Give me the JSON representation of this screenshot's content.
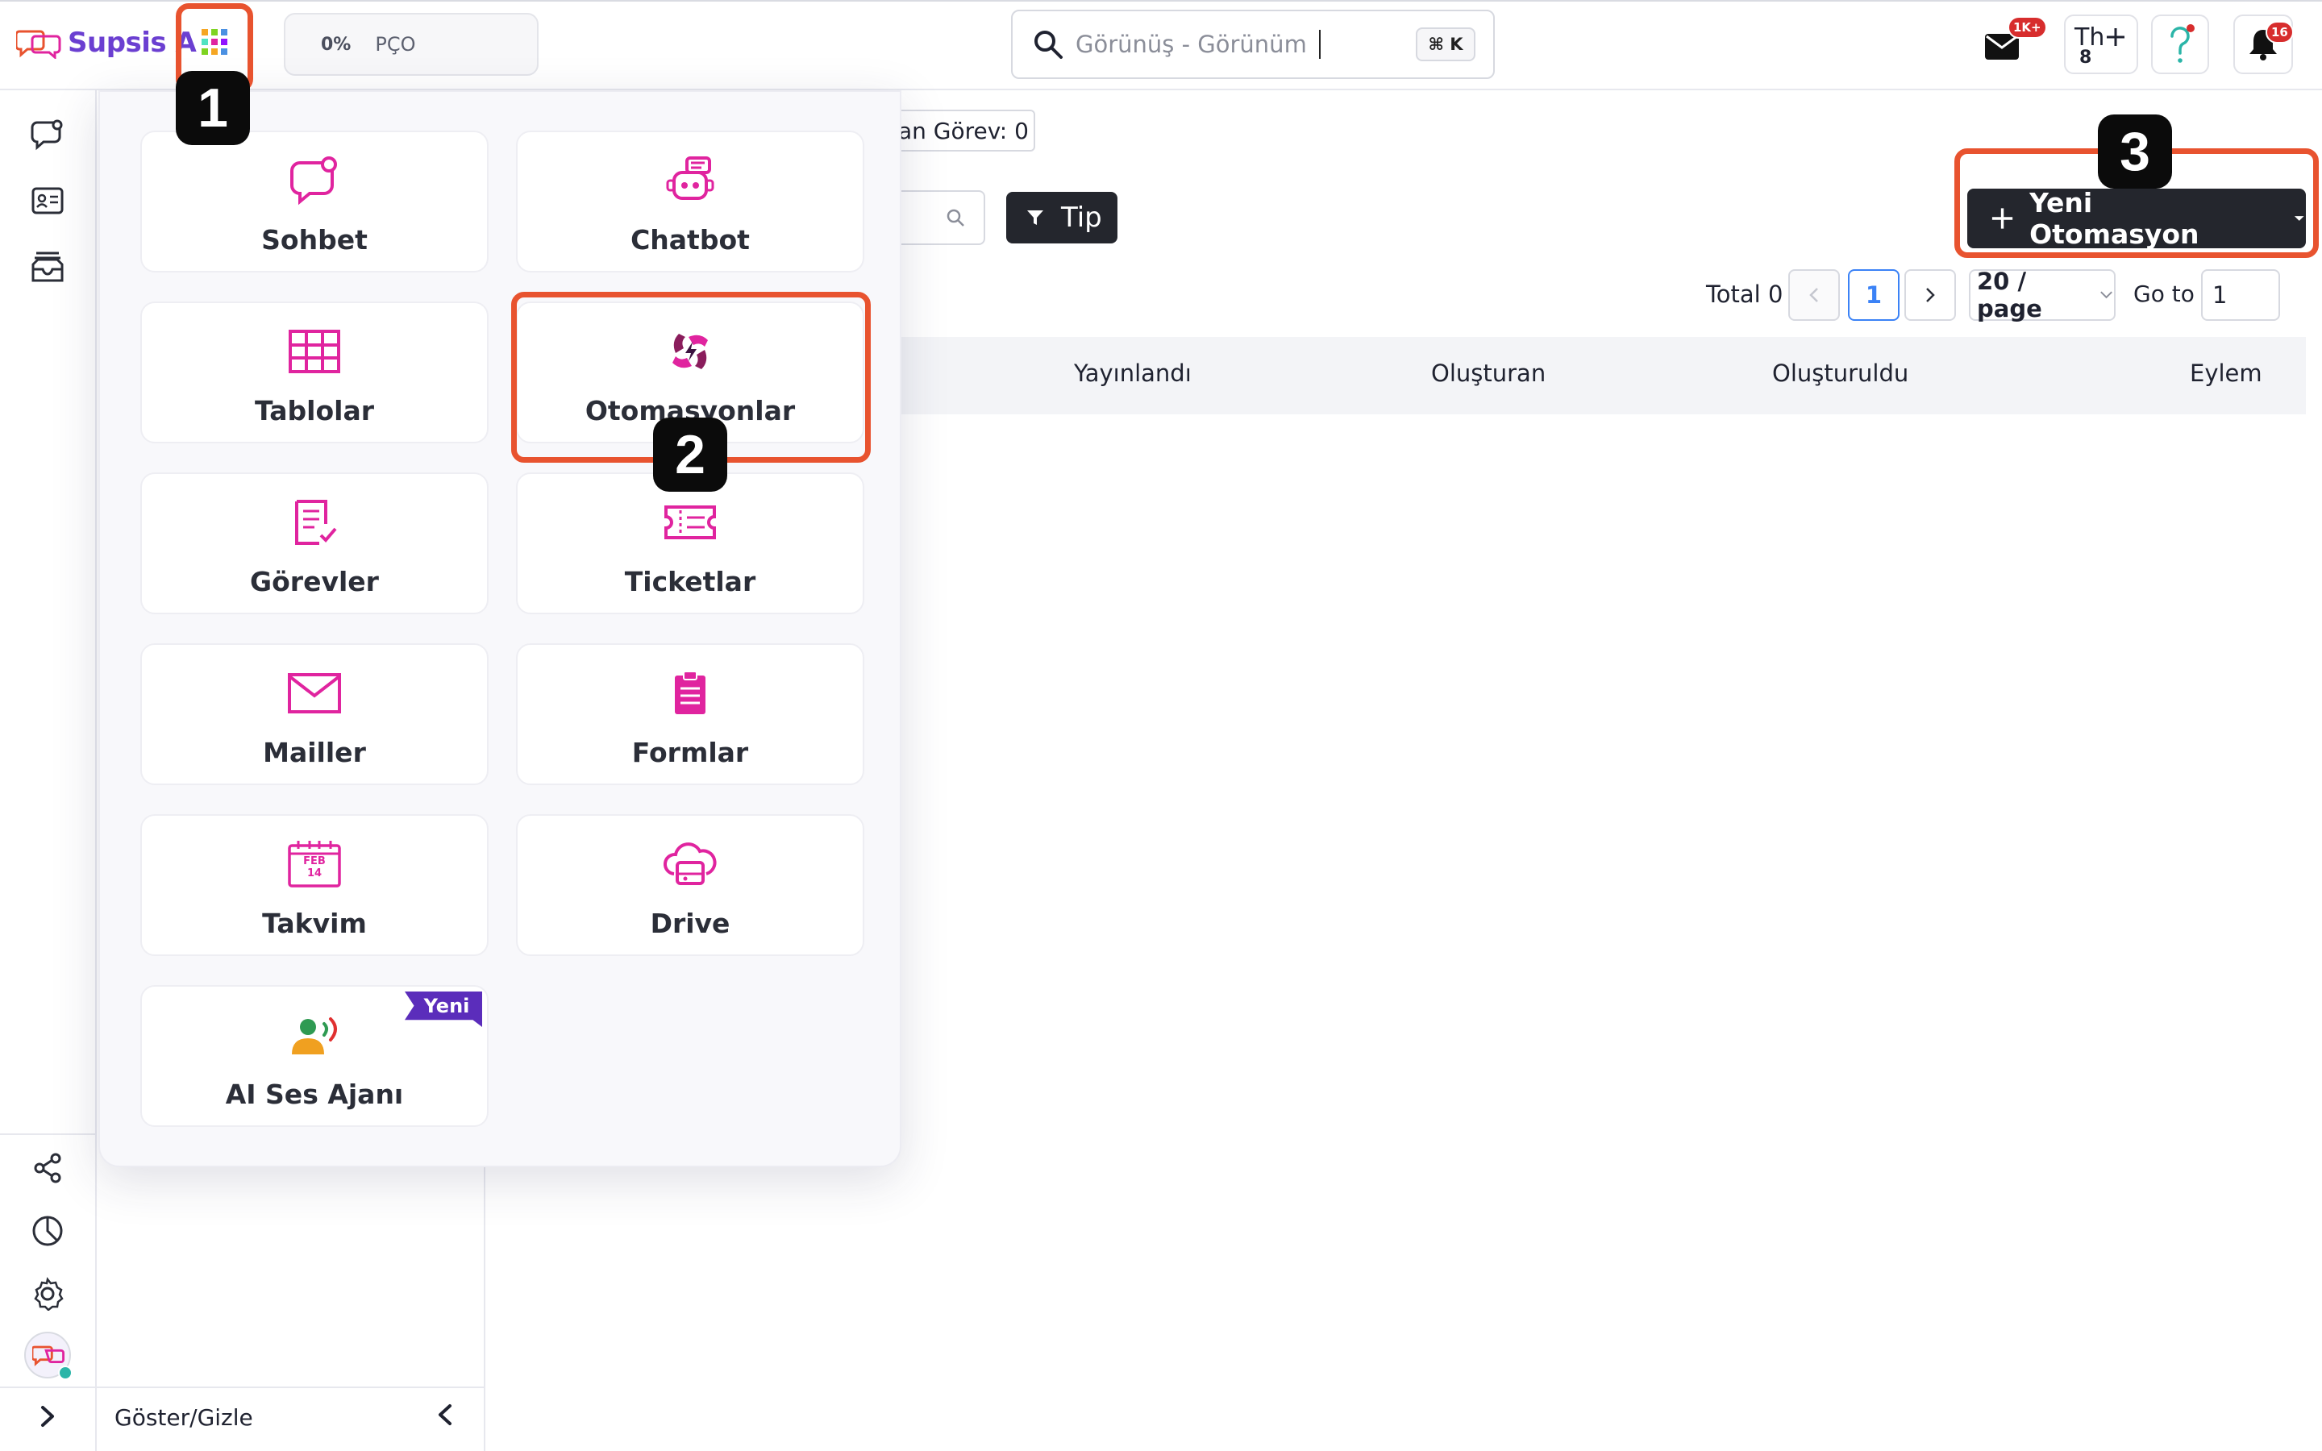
{
  "header": {
    "logo_text": "Supsis A",
    "progress": {
      "percent": "0%",
      "label": "PÇO"
    },
    "search": {
      "text": "Görünüş - Görünüm",
      "shortcut": "⌘ K"
    },
    "mail_badge": "1K+",
    "user_initials": "Th",
    "user_sub": "8",
    "notification_badge": "16"
  },
  "sidebar": {
    "toggle_label": "Göster/Gizle"
  },
  "main": {
    "task_count_label": "an Görev: 0",
    "tip_label": "Tip",
    "new_button_label": "Yeni Otomasyon",
    "pagination": {
      "total": "Total 0",
      "current_page": "1",
      "page_size": "20 / page",
      "go_to_label": "Go to",
      "go_to_value": "1"
    },
    "table_columns": [
      "Yayınlandı",
      "Oluşturan",
      "Oluşturuldu",
      "Eylem"
    ]
  },
  "apps_menu": {
    "items": [
      {
        "label": "Sohbet",
        "icon": "chat-icon"
      },
      {
        "label": "Chatbot",
        "icon": "robot-icon"
      },
      {
        "label": "Tablolar",
        "icon": "table-icon"
      },
      {
        "label": "Otomasyonlar",
        "icon": "automation-icon"
      },
      {
        "label": "Görevler",
        "icon": "task-list-icon"
      },
      {
        "label": "Ticketlar",
        "icon": "ticket-icon"
      },
      {
        "label": "Mailler",
        "icon": "mail-icon"
      },
      {
        "label": "Formlar",
        "icon": "form-icon"
      },
      {
        "label": "Takvim",
        "icon": "calendar-icon"
      },
      {
        "label": "Drive",
        "icon": "drive-icon"
      },
      {
        "label": "AI Ses Ajanı",
        "icon": "voice-agent-icon",
        "badge": "Yeni"
      }
    ],
    "calendar_month": "FEB",
    "calendar_day": "14"
  },
  "annotations": {
    "step1": "1",
    "step2": "2",
    "step3": "3"
  },
  "colors": {
    "accent": "#e0249f",
    "annotation": "#e8532f",
    "brand": "#6b3fd1",
    "dark_button": "#24262d"
  }
}
